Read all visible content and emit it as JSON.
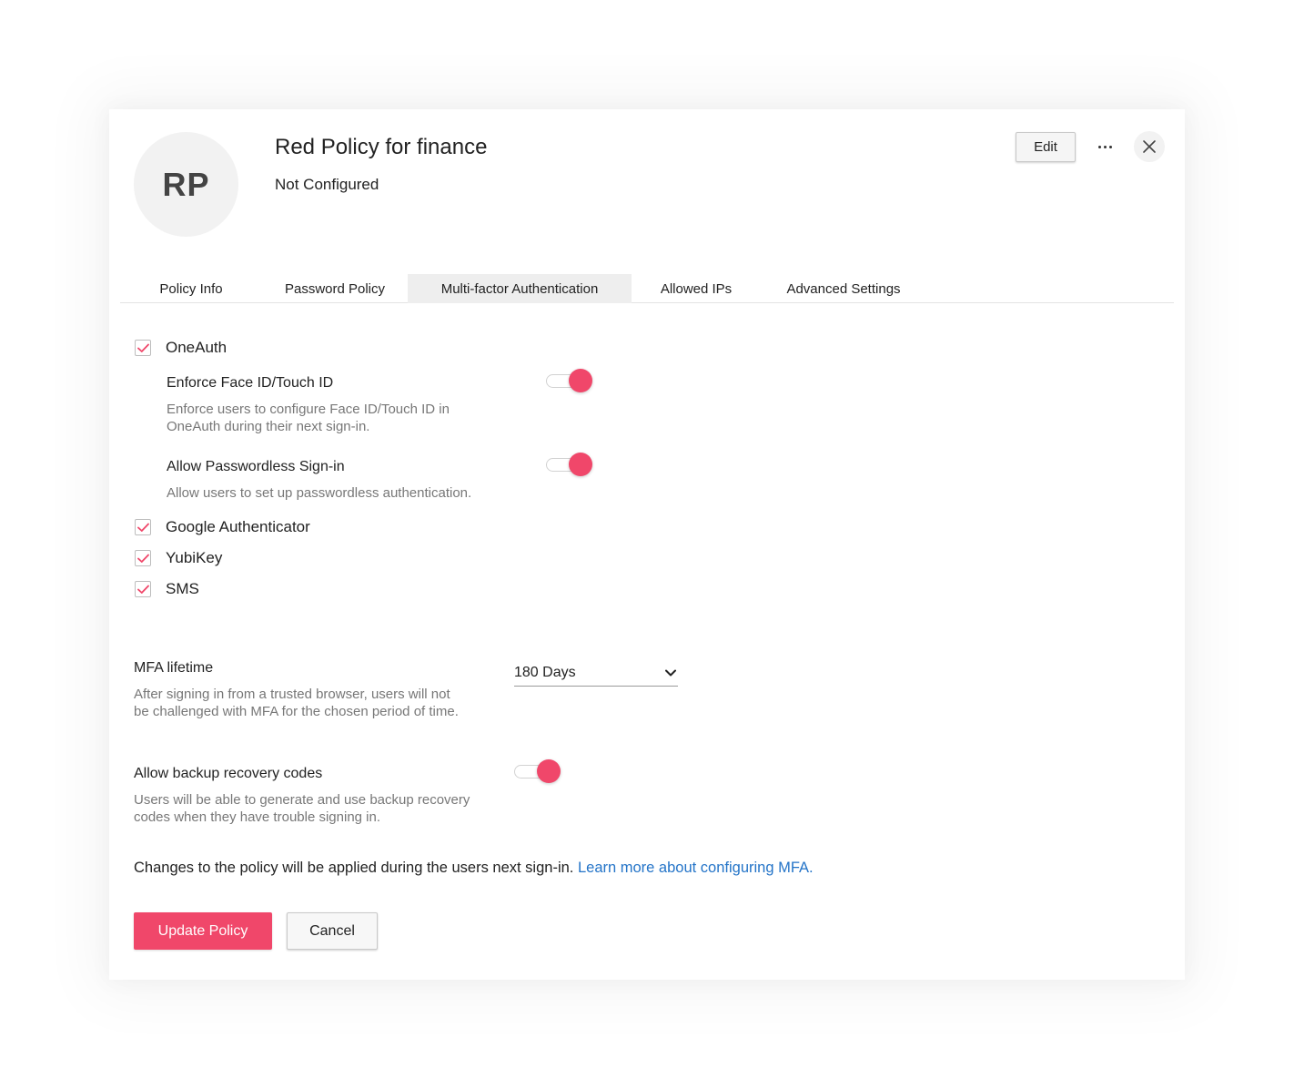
{
  "header": {
    "avatar_initials": "RP",
    "title": "Red Policy for finance",
    "status": "Not Configured",
    "edit_label": "Edit"
  },
  "tabs": [
    {
      "label": "Policy Info",
      "active": false
    },
    {
      "label": "Password Policy",
      "active": false
    },
    {
      "label": "Multi-factor Authentication",
      "active": true
    },
    {
      "label": "Allowed IPs",
      "active": false
    },
    {
      "label": "Advanced Settings",
      "active": false
    }
  ],
  "mfa_methods": {
    "oneauth": {
      "label": "OneAuth",
      "checked": true
    },
    "google_authenticator": {
      "label": "Google Authenticator",
      "checked": true
    },
    "yubikey": {
      "label": "YubiKey",
      "checked": true
    },
    "sms": {
      "label": "SMS",
      "checked": true
    }
  },
  "oneauth_options": {
    "face_id": {
      "title": "Enforce Face ID/Touch ID",
      "desc_line1": "Enforce users to configure Face ID/Touch ID in",
      "desc_line2": "OneAuth during their next sign-in.",
      "enabled": true
    },
    "passwordless": {
      "title": "Allow Passwordless Sign-in",
      "desc": "Allow users to set up passwordless authentication.",
      "enabled": true
    }
  },
  "mfa_lifetime": {
    "title": "MFA lifetime",
    "desc_line1": "After signing in from a trusted browser, users will not",
    "desc_line2": "be challenged with MFA for the chosen period of time.",
    "selected": "180 Days"
  },
  "backup_codes": {
    "title": "Allow backup recovery codes",
    "desc_line1": "Users will be able to generate and use backup recovery",
    "desc_line2": "codes when they have trouble signing in.",
    "enabled": true
  },
  "footer": {
    "note": "Changes to the policy will be applied during the users next sign-in.",
    "link_text": "Learn more about configuring MFA.",
    "update_label": "Update Policy",
    "cancel_label": "Cancel"
  },
  "colors": {
    "accent": "#f0476a",
    "link": "#2474c8",
    "muted_text": "#777777"
  }
}
